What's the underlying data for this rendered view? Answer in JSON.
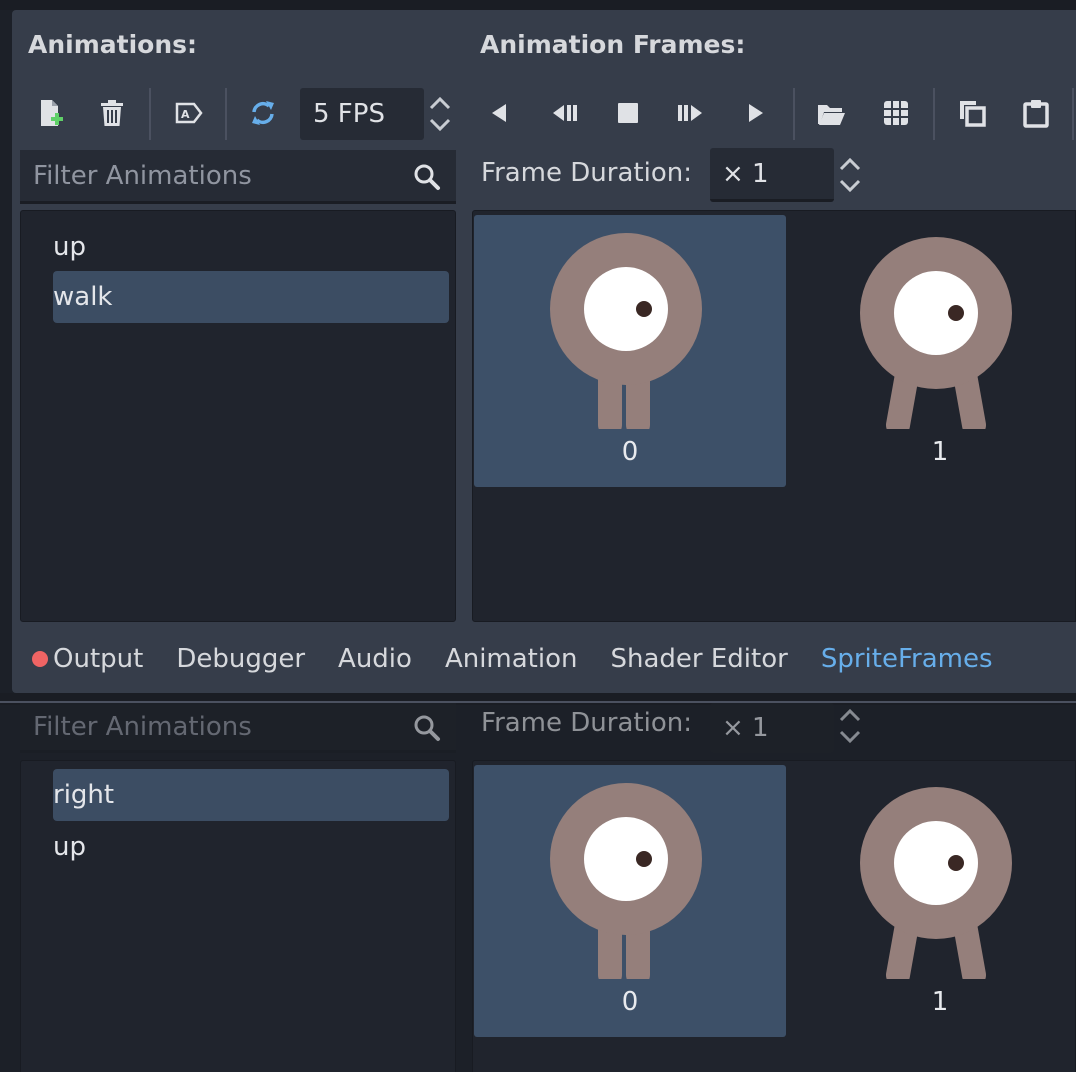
{
  "headings": {
    "animations": "Animations:",
    "animation_frames": "Animation Frames:"
  },
  "toolbar": {
    "icons": [
      "new-animation-icon",
      "delete-animation-icon",
      "rename-animation-icon",
      "loop-icon",
      "play-backwards-icon",
      "step-back-icon",
      "stop-icon",
      "step-forward-icon",
      "play-icon",
      "open-folder-icon",
      "grid-icon",
      "copy-icon",
      "paste-icon"
    ],
    "fps_value": "5 FPS",
    "accent_color": "#67aeea"
  },
  "top": {
    "filter_placeholder": "Filter Animations",
    "frame_duration_label": "Frame Duration:",
    "frame_duration_value": "× 1",
    "animations": [
      "up",
      "walk"
    ],
    "selected_animation": "walk",
    "frames": [
      "0",
      "1"
    ]
  },
  "bottom_tabs": {
    "output": "Output",
    "debugger": "Debugger",
    "audio": "Audio",
    "animation": "Animation",
    "shader_editor": "Shader Editor",
    "spriteframes": "SpriteFrames",
    "error_dot_color": "#f06464"
  },
  "bottom": {
    "filter_placeholder": "Filter Animations",
    "frame_duration_label": "Frame Duration:",
    "frame_duration_value": "× 1",
    "animations": [
      "right",
      "up"
    ],
    "selected_animation": "right",
    "frames": [
      "0",
      "1"
    ]
  }
}
